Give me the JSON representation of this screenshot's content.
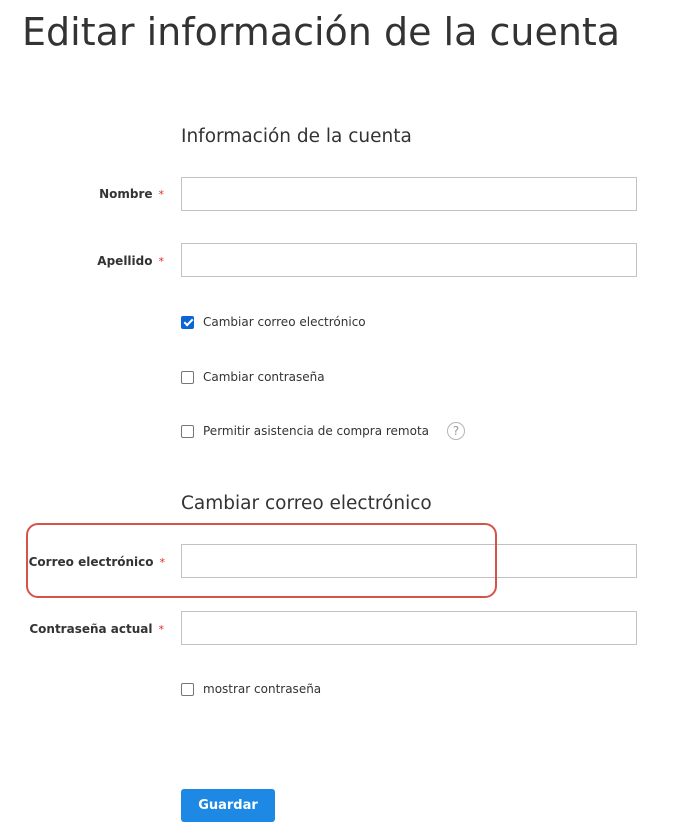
{
  "page": {
    "title": "Editar información de la cuenta"
  },
  "account_info": {
    "section_title": "Información de la cuenta",
    "first_name": {
      "label": "Nombre",
      "required_mark": "*",
      "value": ""
    },
    "last_name": {
      "label": "Apellido",
      "required_mark": "*",
      "value": ""
    },
    "options": {
      "change_email": {
        "label": "Cambiar correo electrónico",
        "checked": true
      },
      "change_password": {
        "label": "Cambiar contraseña",
        "checked": false
      },
      "remote_assistance": {
        "label": "Permitir asistencia de compra remota",
        "checked": false,
        "help_icon_glyph": "?"
      }
    }
  },
  "change_email": {
    "section_title": "Cambiar correo electrónico",
    "email": {
      "label": "Correo electrónico",
      "required_mark": "*",
      "value": ""
    },
    "current_password": {
      "label": "Contraseña actual",
      "required_mark": "*",
      "value": ""
    },
    "show_password": {
      "label": "mostrar contraseña",
      "checked": false
    }
  },
  "actions": {
    "save_label": "Guardar"
  },
  "colors": {
    "accent": "#1e88e5",
    "checkbox_checked": "#0a66d6",
    "required": "#e02b27",
    "highlight": "#d5544a"
  }
}
